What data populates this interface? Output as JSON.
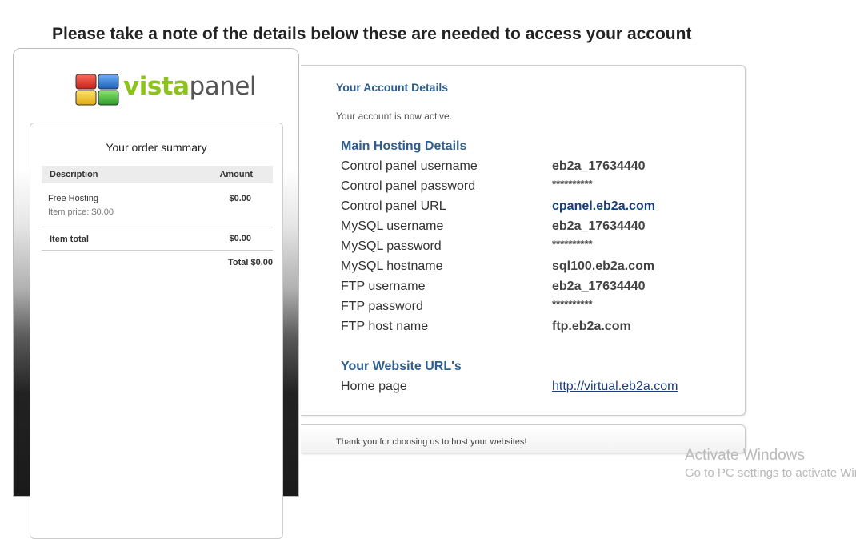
{
  "page": {
    "heading": "Please take a note of the details below these are needed to access your account"
  },
  "logo": {
    "text_vista": "vista",
    "text_panel": "panel",
    "colors": [
      "#e53a2e",
      "#2b7bd6",
      "#f3c81c",
      "#3fb43a"
    ]
  },
  "order": {
    "title": "Your order summary",
    "headers": {
      "description": "Description",
      "amount": "Amount"
    },
    "item": {
      "name": "Free Hosting",
      "price": "Item price: $0.00",
      "amount": "$0.00"
    },
    "item_total": {
      "label": "Item total",
      "amount": "$0.00"
    },
    "grand_total": "Total $0.00"
  },
  "account": {
    "title": "Your Account Details",
    "status": "Your account is now active.",
    "main_title": "Main Hosting Details",
    "rows": [
      {
        "label": "Control panel username",
        "value": "eb2a_17634440"
      },
      {
        "label": "Control panel password",
        "value": "**********"
      },
      {
        "label": "Control panel URL",
        "value": "cpanel.eb2a.com"
      },
      {
        "label": "MySQL username",
        "value": "eb2a_17634440"
      },
      {
        "label": "MySQL password",
        "value": "**********"
      },
      {
        "label": "MySQL hostname",
        "value": "sql100.eb2a.com"
      },
      {
        "label": "FTP username",
        "value": "eb2a_17634440"
      },
      {
        "label": "FTP password",
        "value": "**********"
      },
      {
        "label": "FTP host name",
        "value": "ftp.eb2a.com"
      }
    ],
    "website_title": "Your Website URL's",
    "website_row": {
      "label": "Home page",
      "value": "http://virtual.eb2a.com"
    }
  },
  "footer": {
    "text": "Thank you for choosing us to host your websites!"
  },
  "watermark": {
    "line1": "Activate Windows",
    "line2": "Go to PC settings to activate Wir"
  }
}
